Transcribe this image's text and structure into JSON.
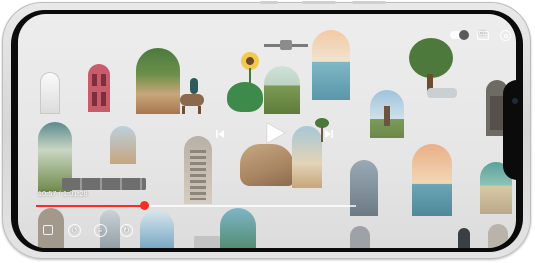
{
  "player": {
    "current_time": "10:57",
    "duration": "1:01:28",
    "time_separator": " / ",
    "progress": 0.34,
    "progress_color": "#ff2a20",
    "autoplay_on": true
  },
  "icons": {
    "autoplay": "autoplay-toggle-icon",
    "captions": "captions-icon",
    "settings": "settings-gear-icon",
    "previous": "previous-track-icon",
    "play": "play-icon",
    "next": "next-track-icon",
    "fullscreen": "fullscreen-icon",
    "skip_back": "skip-back-icon",
    "chapters": "chapters-list-icon",
    "skip_forward": "skip-forward-icon"
  },
  "colors": {
    "background": "#e6e6e6",
    "phone_bezel": "#0b0b0b"
  }
}
